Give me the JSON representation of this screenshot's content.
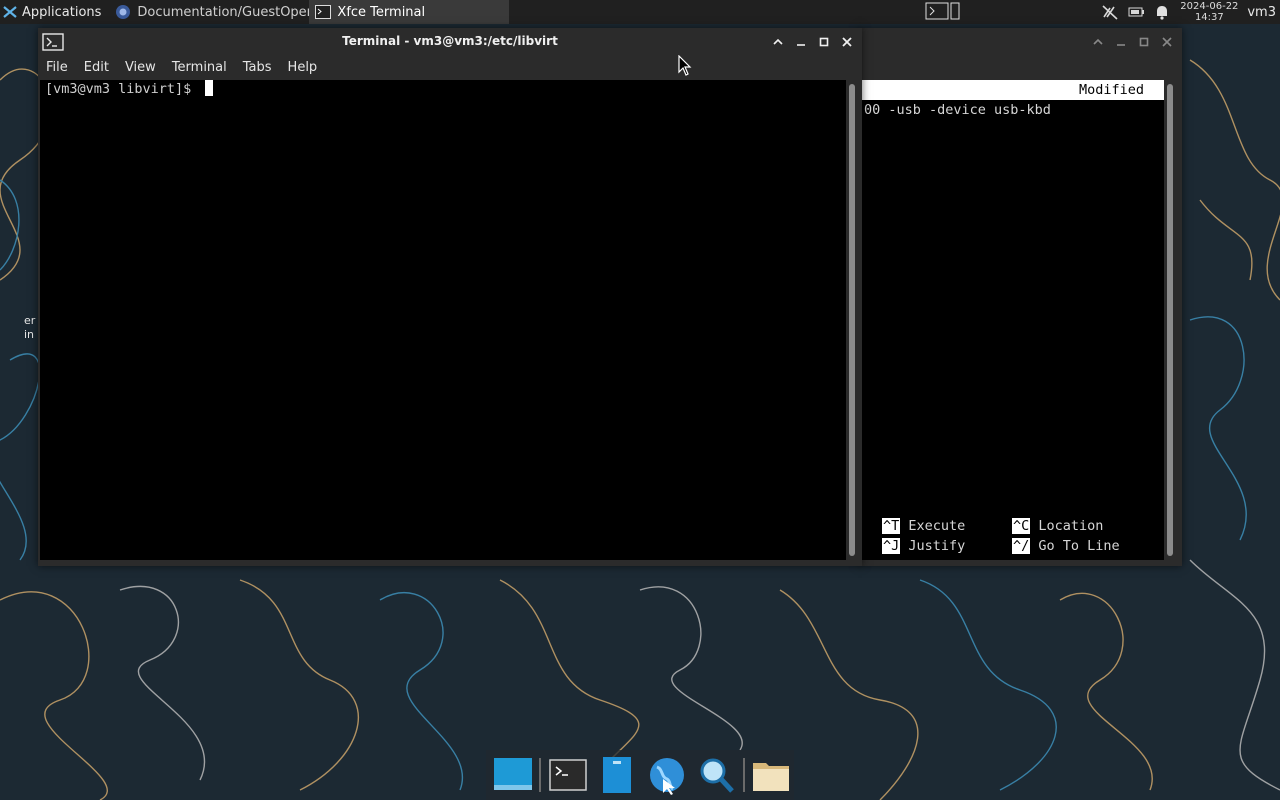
{
  "top_panel": {
    "applications_label": "Applications",
    "tasks": [
      {
        "label": "Documentation/GuestOper...",
        "icon": "browser-icon",
        "active": false
      },
      {
        "label": "Xfce Terminal",
        "icon": "terminal-icon",
        "active": true
      }
    ],
    "clock_date": "2024-06-22",
    "clock_time": "14:37",
    "user": "vm3"
  },
  "main_window": {
    "title": "Terminal - vm3@vm3:/etc/libvirt",
    "menu": [
      "File",
      "Edit",
      "View",
      "Terminal",
      "Tabs",
      "Help"
    ],
    "prompt": "[vm3@vm3 libvirt]$ "
  },
  "back_window": {
    "status": "Modified",
    "line": "00 -usb -device usb-kbd",
    "help": [
      {
        "key": "^T",
        "label": "Execute"
      },
      {
        "key": "^C",
        "label": "Location"
      },
      {
        "key": "^J",
        "label": "Justify"
      },
      {
        "key": "^/",
        "label": "Go To Line"
      }
    ]
  },
  "desktop_edge_text": [
    "er",
    "in"
  ],
  "dock": [
    "desktop-icon",
    "terminal-icon",
    "file-manager-icon",
    "web-browser-icon",
    "search-icon",
    "folder-icon"
  ],
  "colors": {
    "panel": "#202020",
    "background": "#1d2a35",
    "terminal_bg": "#000000"
  }
}
